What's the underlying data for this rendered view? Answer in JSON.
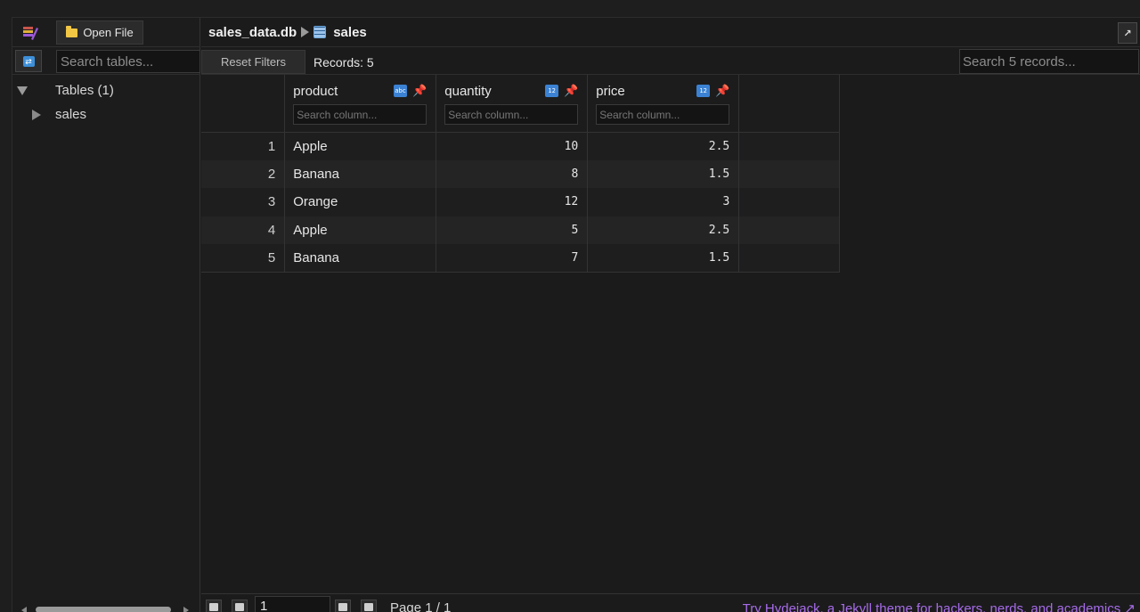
{
  "sidebar": {
    "open_file_label": "Open File",
    "search_placeholder": "Search tables...",
    "tree": {
      "root_label": "Tables (1)",
      "items": [
        "sales"
      ]
    }
  },
  "header": {
    "db_name": "sales_data.db",
    "table_name": "sales",
    "expand_glyph": "↗"
  },
  "toolbar": {
    "reset_label": "Reset Filters",
    "records_label": "Records: 5",
    "search_placeholder": "Search 5 records..."
  },
  "grid": {
    "columns": [
      {
        "name": "product",
        "type_icon": "text-type-icon",
        "type_glyph": "abc",
        "search_placeholder": "Search column..."
      },
      {
        "name": "quantity",
        "type_icon": "number-type-icon",
        "type_glyph": "12",
        "search_placeholder": "Search column..."
      },
      {
        "name": "price",
        "type_icon": "number-type-icon",
        "type_glyph": "12",
        "search_placeholder": "Search column..."
      }
    ],
    "rows": [
      {
        "idx": "1",
        "product": "Apple",
        "quantity": "10",
        "price": "2.5"
      },
      {
        "idx": "2",
        "product": "Banana",
        "quantity": "8",
        "price": "1.5"
      },
      {
        "idx": "3",
        "product": "Orange",
        "quantity": "12",
        "price": "3"
      },
      {
        "idx": "4",
        "product": "Apple",
        "quantity": "5",
        "price": "2.5"
      },
      {
        "idx": "5",
        "product": "Banana",
        "quantity": "7",
        "price": "1.5"
      }
    ]
  },
  "pager": {
    "page_value": "1",
    "page_label": "Page 1 / 1"
  },
  "promo": {
    "text": "Try Hydejack, a Jekyll theme for hackers, nerds, and academics ↗"
  },
  "colors": {
    "accent_blue": "#3b82d4",
    "pin_red": "#e2355a",
    "promo_purple": "#a66be8"
  }
}
